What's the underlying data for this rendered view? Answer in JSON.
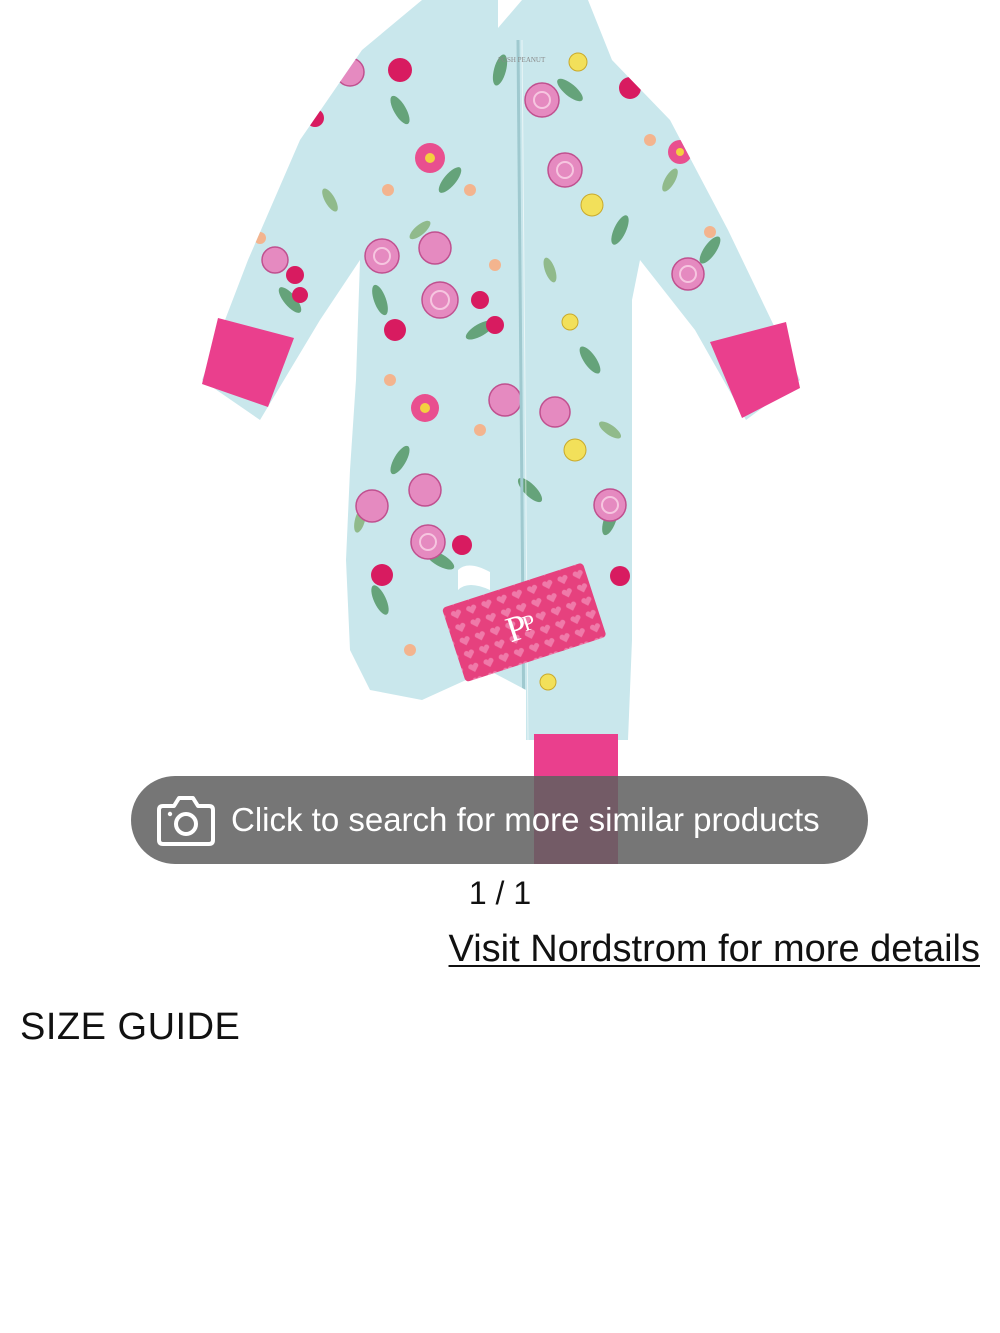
{
  "product": {
    "image_alt": "Floral print zip footie pajama with pink cuffs"
  },
  "visual_search": {
    "label": "Click to search for more similar products",
    "icon": "camera-icon"
  },
  "gallery": {
    "pager": "1 / 1"
  },
  "retailer": {
    "link_label": "Visit Nordstrom for more details"
  },
  "size_guide": {
    "label": "SIZE GUIDE"
  },
  "colors": {
    "fabric": "#c9e7ec",
    "cuff_pink": "#ea3f8d",
    "overlay": "#5f5f5f",
    "text": "#111111"
  }
}
